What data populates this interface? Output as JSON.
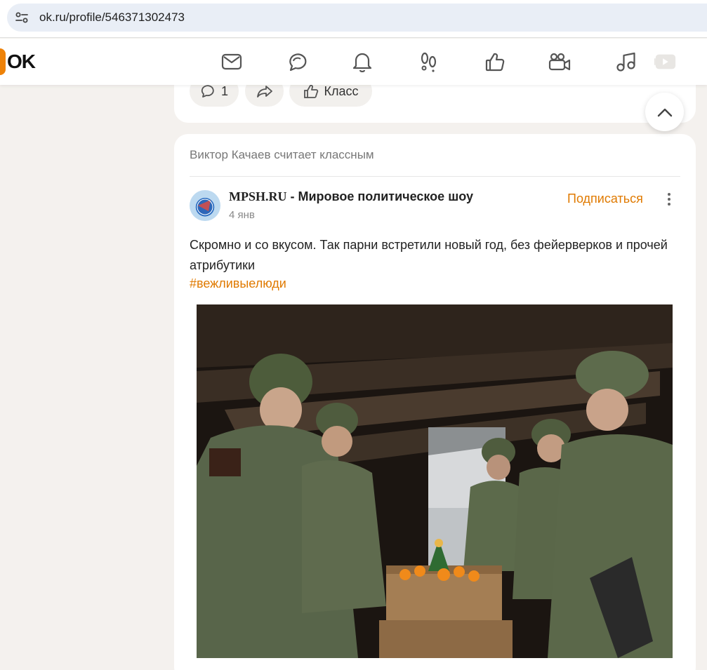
{
  "browser": {
    "url": "ok.ru/profile/546371302473",
    "site_icon": "tune-icon"
  },
  "header": {
    "logo_text": "OK",
    "nav_icons": [
      "messages-icon",
      "discussions-icon",
      "notifications-icon",
      "guests-icon",
      "likes-icon",
      "video-call-icon",
      "music-icon",
      "video-icon"
    ]
  },
  "prev_post_actions": {
    "comments_count": "1",
    "share_icon": "share-icon",
    "like_label": "Класс"
  },
  "post": {
    "activity": "Виктор Качаев считает классным",
    "group_brand": "MPSH.RU",
    "group_title": " - Мировое политическое шоу",
    "date": "4 янв",
    "subscribe_label": "Подписаться",
    "text": "Скромно и со вкусом. Так парни встретили новый год, без фейерверков и прочей атрибутики",
    "hashtag": "#вежливыелюди",
    "photo_icon": "photo-soldiers-in-dugout"
  },
  "colors": {
    "accent": "#ee8208",
    "link": "#e07a00",
    "background": "#f4f1ee"
  }
}
